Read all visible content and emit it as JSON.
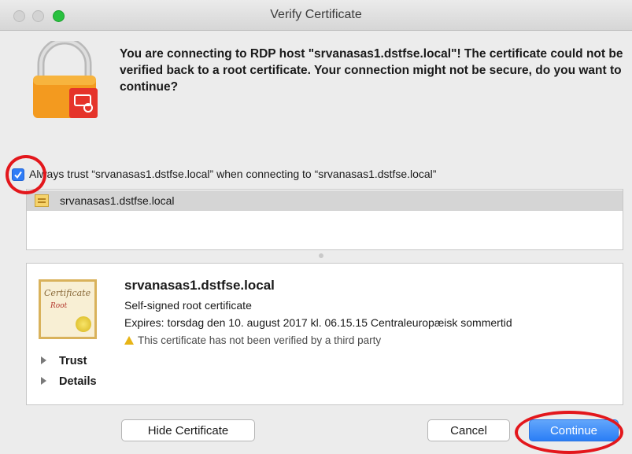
{
  "window": {
    "title": "Verify Certificate"
  },
  "message": "You are connecting to RDP host \"srvanasas1.dstfse.local\"! The certificate could not be verified back to a root certificate. Your connection might not be secure, do you want to continue?",
  "trust_checkbox": {
    "checked": true,
    "label": "Always trust “srvanasas1.dstfse.local” when connecting to “srvanasas1.dstfse.local”"
  },
  "certificate_list": {
    "items": [
      {
        "label": "srvanasas1.dstfse.local"
      }
    ]
  },
  "certificate": {
    "image_text": "Certificate",
    "image_subtext": "Root",
    "name": "srvanasas1.dstfse.local",
    "type": "Self-signed root certificate",
    "expires": "Expires: torsdag den 10. august 2017 kl. 06.15.15 Centraleuropæisk sommertid",
    "warning": "This certificate has not been verified by a third party"
  },
  "sections": [
    {
      "label": "Trust"
    },
    {
      "label": "Details"
    }
  ],
  "buttons": {
    "hide_certificate": "Hide Certificate",
    "cancel": "Cancel",
    "continue": "Continue"
  },
  "colors": {
    "accent": "#2b7ef6",
    "annotation": "#e3171c",
    "checkbox": "#2f7cf6"
  }
}
